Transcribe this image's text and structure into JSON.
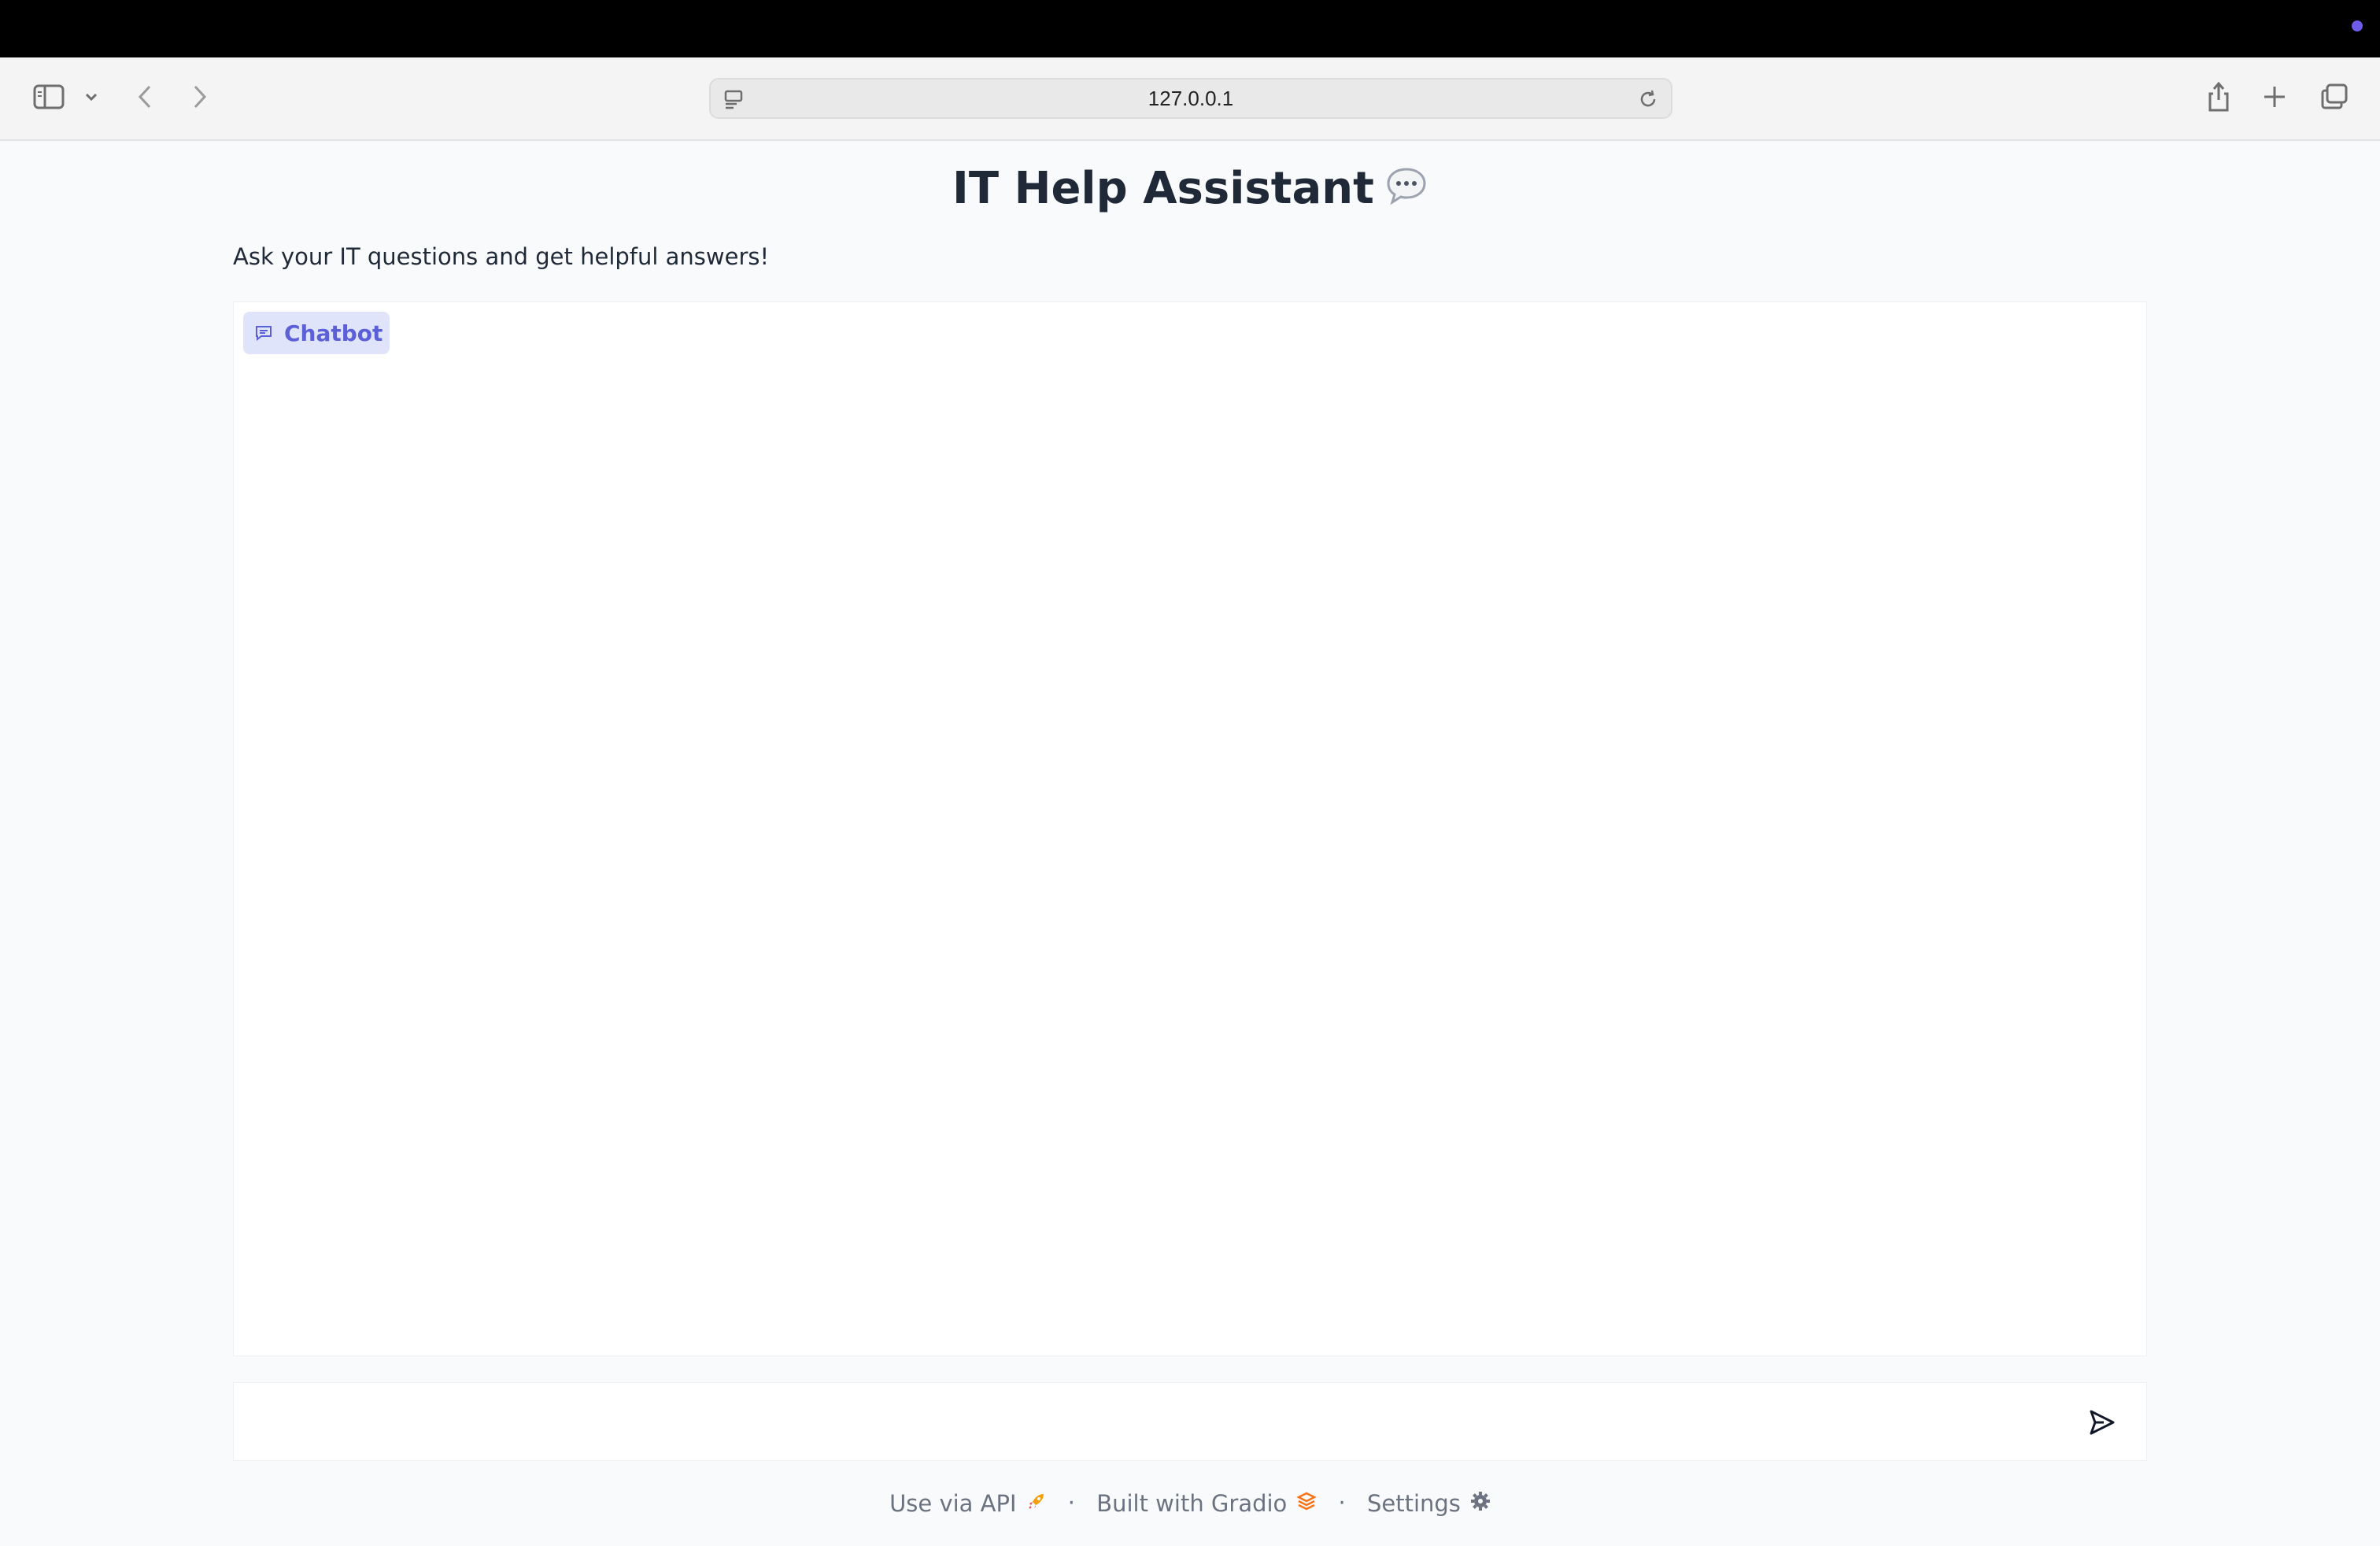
{
  "browser": {
    "url": "127.0.0.1",
    "accent": "#6d5ce7"
  },
  "header": {
    "title": "IT Help Assistant",
    "title_icon": "speech-bubble-icon",
    "subtitle": "Ask your IT questions and get helpful answers!"
  },
  "chatbot": {
    "label": "Chatbot",
    "label_icon": "chat-icon",
    "accent": "#5b5fd8",
    "label_bg": "#e0e4fb"
  },
  "input": {
    "value": "",
    "placeholder": "",
    "send_icon": "send-icon"
  },
  "footer": {
    "api_label": "Use via API",
    "api_icon": "rocket-icon",
    "separator": "·",
    "gradio_label": "Built with Gradio",
    "gradio_icon": "gradio-logo-icon",
    "settings_label": "Settings",
    "settings_icon": "gear-icon"
  }
}
